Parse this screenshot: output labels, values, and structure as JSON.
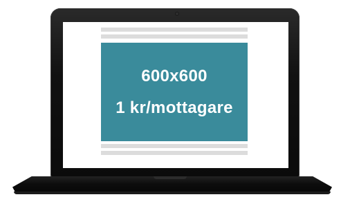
{
  "ad": {
    "size_text": "600x600",
    "price_text": "1 kr/mottagare",
    "background_color": "#3a8b9b",
    "text_color": "#ffffff"
  },
  "device": {
    "type": "laptop",
    "bezel_color": "#111111",
    "screen_color": "#ffffff"
  },
  "placeholder_color": "#dcdcdc"
}
